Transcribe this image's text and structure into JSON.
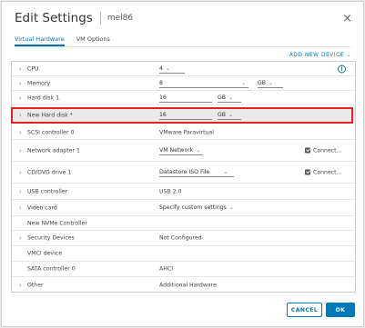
{
  "dialog": {
    "title": "Edit Settings",
    "vm_name": "mel86",
    "close_glyph": "×"
  },
  "tabs": [
    {
      "label": "Virtual Hardware",
      "active": true
    },
    {
      "label": "VM Options",
      "active": false
    }
  ],
  "add_new_device": "ADD NEW DEVICE",
  "add_new_device_chevron": "⌄",
  "rows": {
    "cpu": {
      "label": "CPU",
      "value": "4",
      "dropdown": "⌄",
      "info": "i"
    },
    "memory": {
      "label": "Memory",
      "value": "8",
      "unit": "GB"
    },
    "hard_disk_1": {
      "label": "Hard disk 1",
      "value": "16",
      "unit": "GB"
    },
    "new_hard_disk": {
      "label": "New Hard disk *",
      "value": "16",
      "unit": "GB"
    },
    "scsi": {
      "label": "SCSI controller 0",
      "value": "VMware Paravirtual"
    },
    "network": {
      "label": "Network adapter 1",
      "value": "VM Network",
      "connect": "Connect..."
    },
    "cd_dvd": {
      "label": "CD/DVD drive 1",
      "value": "Datastore ISO File",
      "connect": "Connect..."
    },
    "usb": {
      "label": "USB controller",
      "value": "USB 2.0"
    },
    "video": {
      "label": "Video card",
      "value": "Specify custom settings"
    },
    "nvme": {
      "label": "New NVMe Controller"
    },
    "security": {
      "label": "Security Devices",
      "value": "Not Configured"
    },
    "vmci": {
      "label": "VMCI device"
    },
    "sata": {
      "label": "SATA controller 0",
      "value": "AHCI"
    },
    "other": {
      "label": "Other",
      "value": "Additional Hardware"
    }
  },
  "buttons": {
    "cancel": "CANCEL",
    "ok": "OK"
  },
  "colors": {
    "accent": "#0079b8",
    "highlight": "#e32222"
  }
}
